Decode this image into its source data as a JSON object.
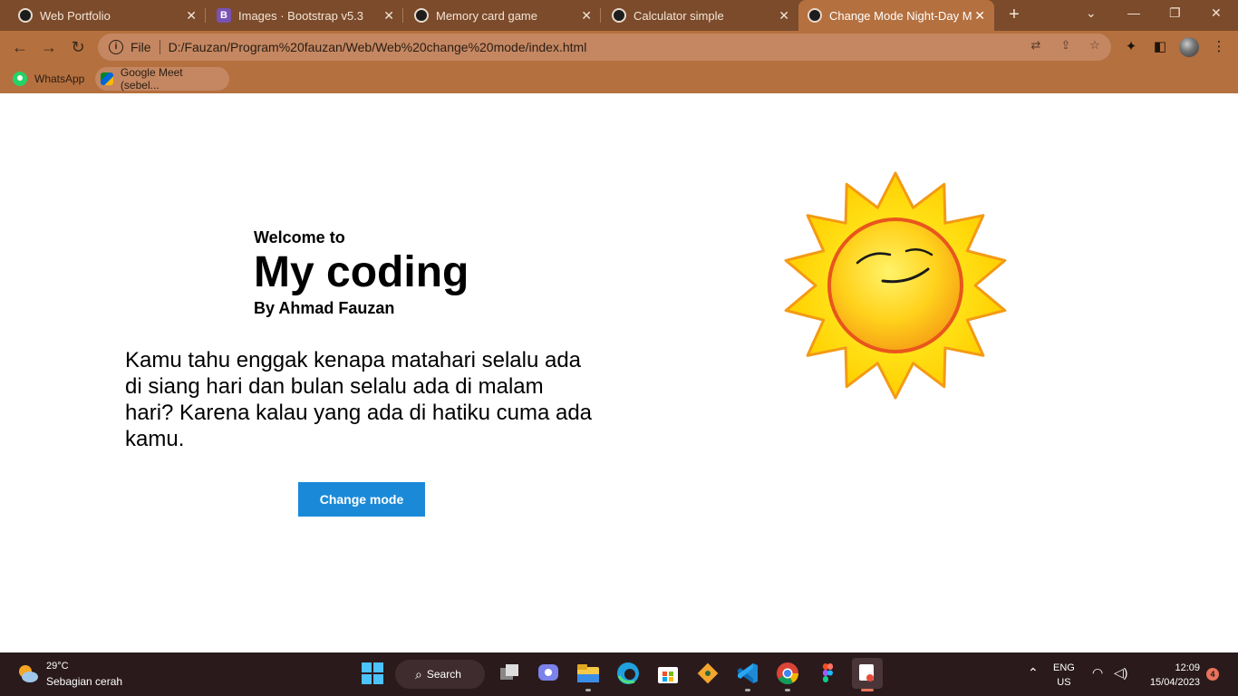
{
  "browser": {
    "tabs": [
      {
        "title": "Web Portfolio"
      },
      {
        "title": "Images · Bootstrap v5.3",
        "favicon": "B"
      },
      {
        "title": "Memory card game"
      },
      {
        "title": "Calculator simple"
      },
      {
        "title": "Change Mode Night-Day Mo"
      }
    ],
    "new_tab": "+",
    "address": {
      "scheme_label": "File",
      "url": "D:/Fauzan/Program%20fauzan/Web/Web%20change%20mode/index.html"
    },
    "bookmarks": [
      {
        "label": "WhatsApp"
      },
      {
        "label": "Google Meet (sebel..."
      }
    ],
    "accent": "#b5703f"
  },
  "page": {
    "welcome": "Welcome to",
    "title": "My coding",
    "byline": "By Ahmad Fauzan",
    "quote": "Kamu tahu enggak kenapa matahari selalu ada di siang hari dan bulan selalu ada di malam hari? Karena kalau yang ada di hatiku cuma ada kamu.",
    "button_label": "Change mode",
    "button_color": "#1a8ad8",
    "illustration": "smiling-sun-icon"
  },
  "taskbar": {
    "weather": {
      "temp": "29°C",
      "desc": "Sebagian cerah"
    },
    "search_label": "Search",
    "lang": {
      "line1": "ENG",
      "line2": "US"
    },
    "clock": {
      "time": "12:09",
      "date": "15/04/2023"
    },
    "notification_count": "4"
  }
}
